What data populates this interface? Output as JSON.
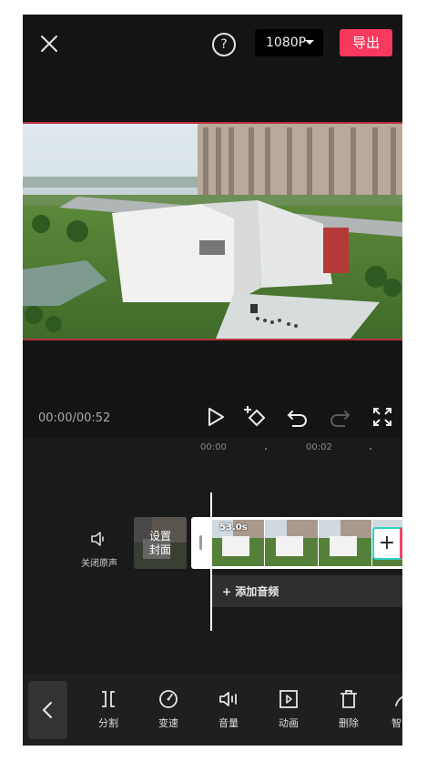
{
  "topbar": {
    "resolution": "1080P",
    "export_label": "导出",
    "help_glyph": "?"
  },
  "playback": {
    "timecode": "00:00/00:52"
  },
  "timeline": {
    "ruler": [
      "00:00",
      "00:02"
    ],
    "mute_label": "关闭原声",
    "cover_label_line1": "设置",
    "cover_label_line2": "封面",
    "clip_duration": "53.0s",
    "add_clip_glyph": "+",
    "add_audio_label": "+ 添加音频"
  },
  "toolbar": {
    "items": [
      {
        "label": "分割",
        "icon": "split-icon"
      },
      {
        "label": "变速",
        "icon": "speed-icon"
      },
      {
        "label": "音量",
        "icon": "volume-icon"
      },
      {
        "label": "动画",
        "icon": "animation-icon"
      },
      {
        "label": "删除",
        "icon": "delete-icon"
      },
      {
        "label": "智能",
        "icon": "smart-icon"
      }
    ]
  },
  "colors": {
    "accent": "#f6395c",
    "background": "#141414"
  }
}
